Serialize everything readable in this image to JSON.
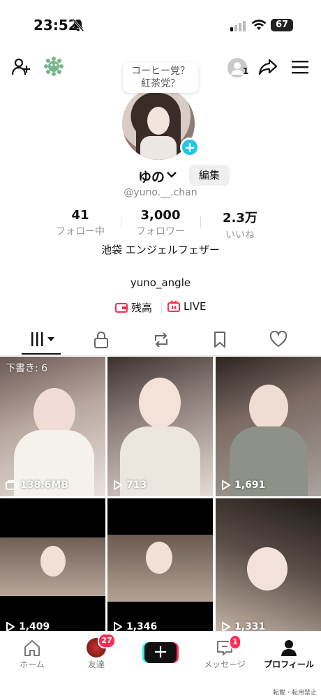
{
  "status_bar": {
    "time": "23:52",
    "battery": "67"
  },
  "header": {
    "add_friend_icon": "person-add-icon",
    "pet_icon": "green-leaf-icon",
    "viewers_count": "1",
    "tooltip_line1": "コーヒー党？",
    "tooltip_line2": "紅茶党？"
  },
  "profile": {
    "name": "ゆの",
    "edit_label": "編集",
    "handle": "@yuno.__.chan",
    "bio": "池袋 エンジェルフェザー",
    "link": "yuno_angle"
  },
  "stats": [
    {
      "num": "41",
      "label": "フォロー中"
    },
    {
      "num": "3,000",
      "label": "フォロワー"
    },
    {
      "num": "2.3万",
      "label": "いいね"
    }
  ],
  "actions": {
    "balance": "残高",
    "live": "LIVE"
  },
  "videos": [
    {
      "draft": "下書き: 6",
      "meta": "138.6MB",
      "meta_icon": "storage-icon"
    },
    {
      "meta": "713",
      "meta_icon": "play-icon"
    },
    {
      "meta": "1,691",
      "meta_icon": "play-icon"
    },
    {
      "meta": "1,409",
      "meta_icon": "play-icon"
    },
    {
      "meta": "1,346",
      "meta_icon": "play-icon"
    },
    {
      "meta": "1,331",
      "meta_icon": "play-icon"
    }
  ],
  "bottom_nav": {
    "home": "ホーム",
    "friends": "友達",
    "friends_badge": "27",
    "messages": "メッセージ",
    "messages_badge": "1",
    "profile": "プロフィール"
  },
  "footer_note": "転載・転用禁止"
}
